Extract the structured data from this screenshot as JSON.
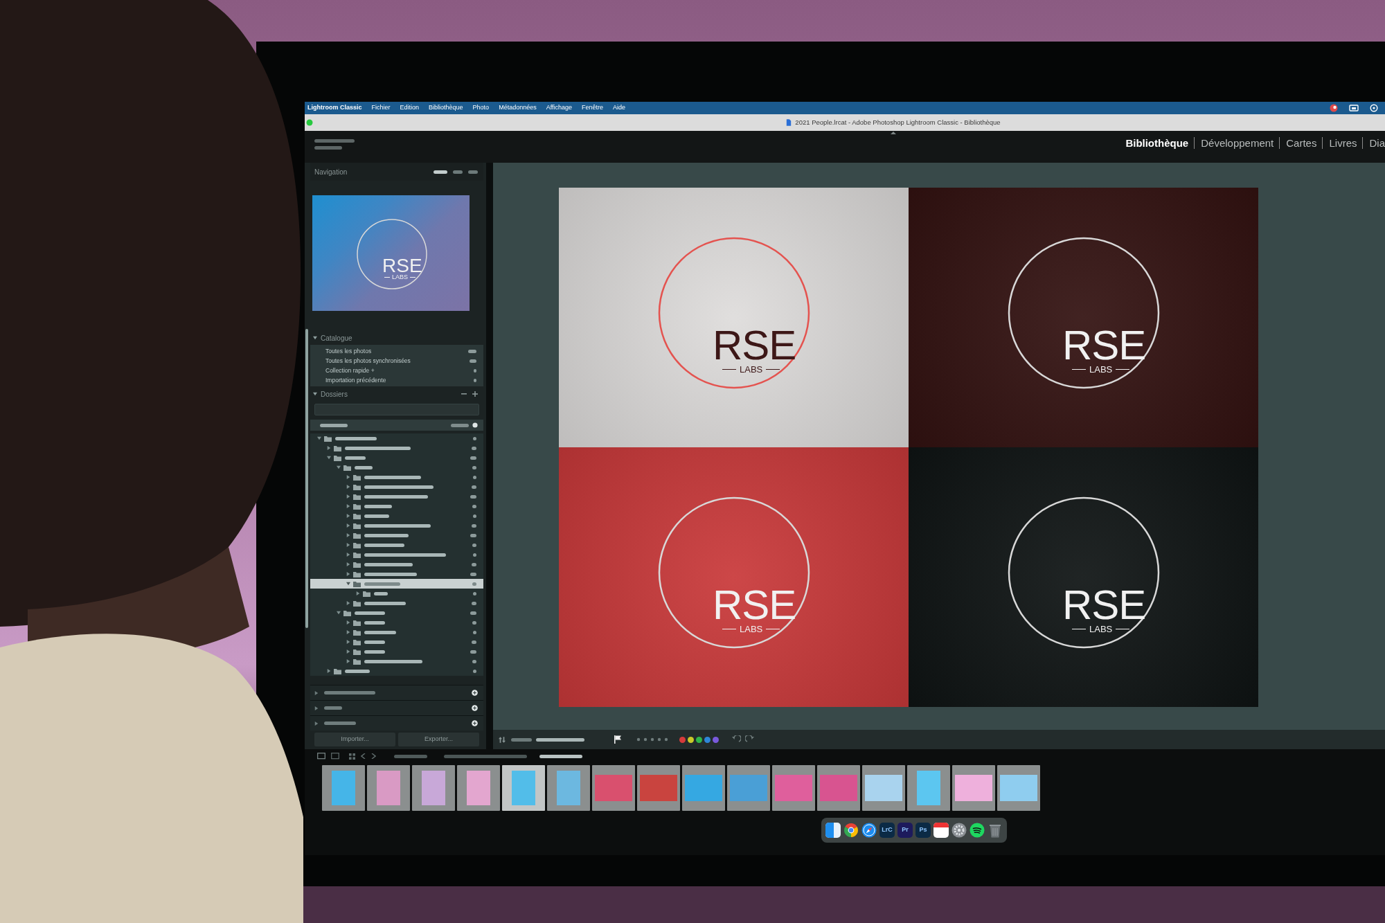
{
  "menu_bar": {
    "app_name": "Lightroom Classic",
    "items": [
      "Fichier",
      "Edition",
      "Bibliothèque",
      "Photo",
      "Métadonnées",
      "Affichage",
      "Fenêtre",
      "Aide"
    ]
  },
  "window": {
    "title": "2021 People.lrcat - Adobe Photoshop Lightroom Classic - Bibliothèque"
  },
  "module_picker": [
    {
      "label": "Bibliothèque",
      "selected": true
    },
    {
      "label": "Développement",
      "selected": false
    },
    {
      "label": "Cartes",
      "selected": false
    },
    {
      "label": "Livres",
      "selected": false
    },
    {
      "label": "Dia",
      "selected": false
    }
  ],
  "navigator": {
    "title": "Navigation",
    "preview": {
      "wordmark": "RSE",
      "tagline": "LABS"
    }
  },
  "catalog": {
    "title": "Catalogue",
    "expanded": true,
    "items": [
      {
        "label": "Toutes les photos",
        "selected": false
      },
      {
        "label": "Toutes les photos synchronisées",
        "selected": false
      },
      {
        "label": "Collection rapide +",
        "selected": false
      },
      {
        "label": "Importation précédente",
        "selected": false
      }
    ]
  },
  "folders": {
    "title": "Dossiers",
    "expanded": true,
    "tree": [
      {
        "expanded": true,
        "selected": false,
        "children": [
          {
            "expanded": false,
            "selected": false
          },
          {
            "expanded": true,
            "selected": false,
            "children": [
              {
                "expanded": true,
                "selected": false,
                "children": [
                  {
                    "expanded": false,
                    "selected": false
                  },
                  {
                    "expanded": false,
                    "selected": false
                  },
                  {
                    "expanded": false,
                    "selected": false
                  },
                  {
                    "expanded": false,
                    "selected": false
                  },
                  {
                    "expanded": false,
                    "selected": false
                  },
                  {
                    "expanded": false,
                    "selected": false
                  },
                  {
                    "expanded": false,
                    "selected": false
                  },
                  {
                    "expanded": false,
                    "selected": false
                  },
                  {
                    "expanded": false,
                    "selected": false
                  },
                  {
                    "expanded": false,
                    "selected": false
                  },
                  {
                    "expanded": false,
                    "selected": false
                  },
                  {
                    "expanded": true,
                    "selected": true,
                    "children": [
                      {
                        "expanded": false,
                        "selected": false
                      }
                    ]
                  },
                  {
                    "expanded": false,
                    "selected": false
                  }
                ]
              },
              {
                "expanded": true,
                "selected": false,
                "children": [
                  {
                    "expanded": false,
                    "selected": false
                  },
                  {
                    "expanded": false,
                    "selected": false
                  },
                  {
                    "expanded": false,
                    "selected": false
                  },
                  {
                    "expanded": false,
                    "selected": false
                  },
                  {
                    "expanded": false,
                    "selected": false
                  }
                ]
              }
            ]
          },
          {
            "expanded": false,
            "selected": false
          }
        ]
      }
    ]
  },
  "collapsed_panels": [
    {
      "expanded": false
    },
    {
      "expanded": false
    },
    {
      "expanded": false
    }
  ],
  "left_buttons": [
    "Importer...",
    "Exporter..."
  ],
  "grid": {
    "tiles": [
      {
        "kind": "light",
        "color": "#dedcdb",
        "wordmark": "RSE",
        "tagline": "LABS"
      },
      {
        "kind": "dark",
        "color": "#331211",
        "wordmark": "RSE",
        "tagline": "LABS"
      },
      {
        "kind": "dark",
        "color": "#c9393a",
        "wordmark": "RSE",
        "tagline": "LABS"
      },
      {
        "kind": "dark",
        "color": "#0f1414",
        "wordmark": "RSE",
        "tagline": "LABS"
      }
    ]
  },
  "toolbar": {
    "rating": {
      "stars": 0
    },
    "color_labels": [
      {
        "color": "#d63b3b"
      },
      {
        "color": "#c9c92a"
      },
      {
        "color": "#2fb54a"
      },
      {
        "color": "#2e86d8"
      },
      {
        "color": "#7a5adc"
      }
    ]
  },
  "filmstrip": {
    "thumbnails": [
      {
        "kind": "portrait",
        "color": "#45b5e8",
        "selected": false
      },
      {
        "kind": "portrait",
        "color": "#d99ac4",
        "selected": false
      },
      {
        "kind": "portrait",
        "color": "#c8a8d8",
        "selected": false
      },
      {
        "kind": "portrait",
        "color": "#e3a6cf",
        "selected": false
      },
      {
        "kind": "portrait",
        "color": "#52bde9",
        "selected": true
      },
      {
        "kind": "portrait",
        "color": "#6cb8e0",
        "selected": false
      },
      {
        "kind": "landscape",
        "color": "#d9506e",
        "selected": false
      },
      {
        "kind": "landscape",
        "color": "#c9443f",
        "selected": false
      },
      {
        "kind": "landscape",
        "color": "#35a8e2",
        "selected": false
      },
      {
        "kind": "landscape",
        "color": "#4a9fd6",
        "selected": false
      },
      {
        "kind": "landscape",
        "color": "#df5f9c",
        "selected": false
      },
      {
        "kind": "landscape",
        "color": "#d85490",
        "selected": false
      },
      {
        "kind": "landscape",
        "color": "#a9d3ee",
        "selected": false
      },
      {
        "kind": "portrait",
        "color": "#5cc6f0",
        "selected": false
      },
      {
        "kind": "landscape",
        "color": "#eeb0dc",
        "selected": false
      },
      {
        "kind": "landscape",
        "color": "#8fcdef",
        "selected": false
      }
    ]
  },
  "dock": [
    {
      "kind": "split"
    },
    {
      "kind": "segmented"
    },
    {
      "kind": "compass"
    },
    {
      "kind": "app",
      "label": "LrC",
      "color": "#0b2a45"
    },
    {
      "kind": "app",
      "label": "Pr",
      "color": "#1d1a5c"
    },
    {
      "kind": "app",
      "label": "Ps",
      "color": "#0b2a45"
    },
    {
      "kind": "calendar"
    },
    {
      "kind": "gear"
    },
    {
      "kind": "arcs"
    },
    {
      "kind": "trash"
    }
  ]
}
